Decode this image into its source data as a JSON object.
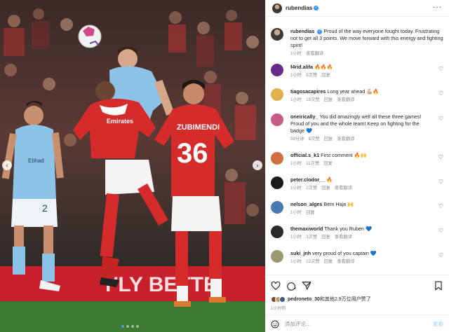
{
  "header": {
    "username": "rubendias",
    "more_icon": "more-horizontal-icon"
  },
  "caption": {
    "username": "rubendias",
    "text": "Proud of the way everyone fought today. Frustrating not to get all 3 points. We move forward with this energy and fighting spirit!",
    "time": "1小时",
    "translate": "查看翻译"
  },
  "photo": {
    "jersey_left_number": "2",
    "jersey_left_sponsor": "Etihad",
    "jersey_main_name": "ZUBIMENDI",
    "jersey_main_number": "36",
    "jersey_red_sponsor": "Emirates",
    "banner_text": "FLY BETTE",
    "colors": {
      "arsenal_red": "#d62b2b",
      "city_blue": "#8ec3e8",
      "pitch": "#3f7a34"
    }
  },
  "comments": [
    {
      "username": "f4rid.alifa",
      "text": "🔥🔥🔥",
      "time": "1小时",
      "likes": "5次赞",
      "reply": "回复",
      "translate": ""
    },
    {
      "username": "tiagosacapires",
      "text": "Long year ahead 💪🏼🔥",
      "time": "1小时",
      "likes": "19次赞",
      "reply": "回复",
      "translate": "查看翻译"
    },
    {
      "username": "oneirically_",
      "text": "You did amazingly well all these three games! Proud of you and the whole team! Keep on fighting for the badge 💙",
      "time": "59分钟",
      "likes": "8次赞",
      "reply": "回复",
      "translate": "查看翻译"
    },
    {
      "username": "official.s_k1",
      "text": "First comment 🔥🙌",
      "time": "1小时",
      "likes": "11次赞",
      "reply": "回复",
      "translate": ""
    },
    {
      "username": "peter.clodor__",
      "text": "🔥",
      "time": "1小时",
      "likes": "2次赞",
      "reply": "回复",
      "translate": "查看翻译"
    },
    {
      "username": "nelson_alges",
      "text": "Bem Haja 🙌",
      "time": "1小时",
      "likes": "",
      "reply": "回复",
      "translate": ""
    },
    {
      "username": "themaxiworld",
      "text": "Thank you Ruben 💙",
      "time": "1小时",
      "likes": "3次赞",
      "reply": "回复",
      "translate": "查看翻译"
    },
    {
      "username": "suki_jnh",
      "text": "very proud of you captain 💙",
      "time": "1小时",
      "likes": "22次赞",
      "reply": "回复",
      "translate": "查看翻译"
    }
  ],
  "engagement": {
    "liked_by_user": "pedroneto_30",
    "liked_by_rest": "和其他2.9万位用户赞了",
    "time": "1小时前",
    "add_comment_placeholder": "添加评论...",
    "post_button": "发布"
  },
  "nav": {
    "prev": "‹",
    "next": "›"
  }
}
